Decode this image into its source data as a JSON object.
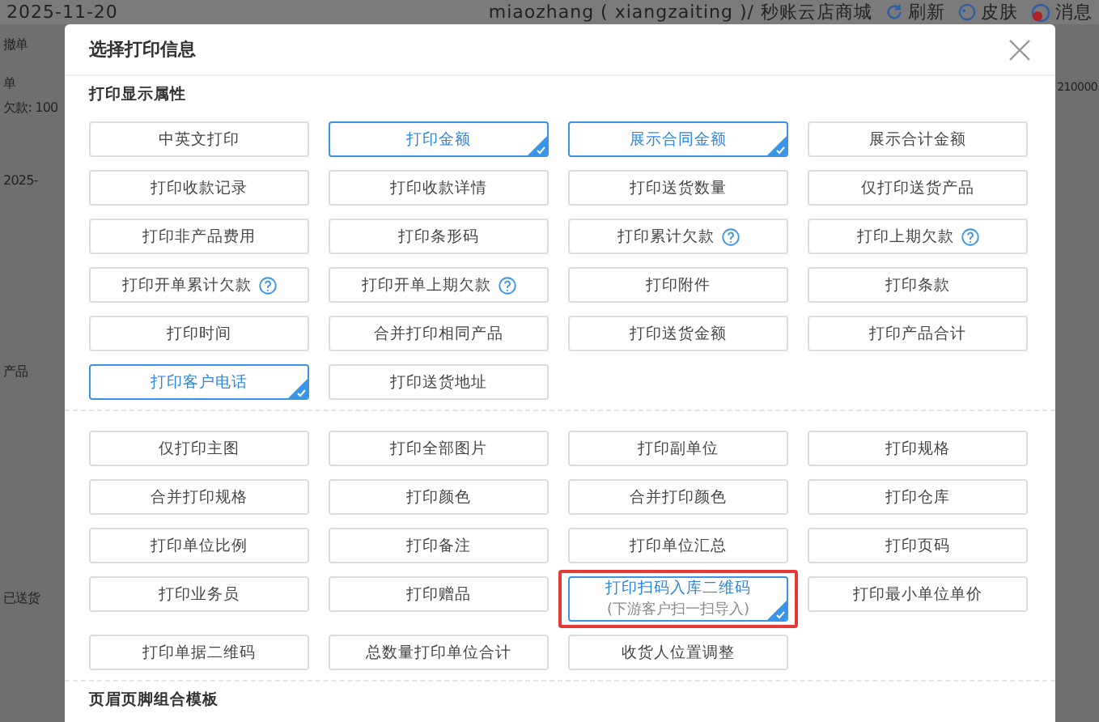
{
  "background": {
    "date": "2025-11-20",
    "user": "miaozhang ( xiangzaiting )/ 秒账云店商城",
    "actions": [
      {
        "label": "刷新",
        "kind": "refresh"
      },
      {
        "label": "皮肤",
        "kind": "skin"
      },
      {
        "label": "消息",
        "kind": "message"
      }
    ],
    "left_texts": [
      "撤单",
      "单",
      "欠款: 100",
      "2025-",
      "产品",
      "已送货"
    ],
    "right_text": "210000"
  },
  "dialog": {
    "title": "选择打印信息",
    "sections": [
      {
        "title": "打印显示属性",
        "options": [
          {
            "label": "中英文打印",
            "selected": false
          },
          {
            "label": "打印金额",
            "selected": true
          },
          {
            "label": "展示合同金额",
            "selected": true
          },
          {
            "label": "展示合计金额",
            "selected": false
          },
          {
            "label": "打印收款记录",
            "selected": false
          },
          {
            "label": "打印收款详情",
            "selected": false
          },
          {
            "label": "打印送货数量",
            "selected": false
          },
          {
            "label": "仅打印送货产品",
            "selected": false
          },
          {
            "label": "打印非产品费用",
            "selected": false
          },
          {
            "label": "打印条形码",
            "selected": false
          },
          {
            "label": "打印累计欠款",
            "selected": false,
            "help": true
          },
          {
            "label": "打印上期欠款",
            "selected": false,
            "help": true
          },
          {
            "label": "打印开单累计欠款",
            "selected": false,
            "help": true
          },
          {
            "label": "打印开单上期欠款",
            "selected": false,
            "help": true
          },
          {
            "label": "打印附件",
            "selected": false
          },
          {
            "label": "打印条款",
            "selected": false
          },
          {
            "label": "打印时间",
            "selected": false
          },
          {
            "label": "合并打印相同产品",
            "selected": false
          },
          {
            "label": "打印送货金额",
            "selected": false
          },
          {
            "label": "打印产品合计",
            "selected": false
          },
          {
            "label": "打印客户电话",
            "selected": true
          },
          {
            "label": "打印送货地址",
            "selected": false
          }
        ]
      },
      {
        "options": [
          {
            "label": "仅打印主图",
            "selected": false
          },
          {
            "label": "打印全部图片",
            "selected": false
          },
          {
            "label": "打印副单位",
            "selected": false
          },
          {
            "label": "打印规格",
            "selected": false
          },
          {
            "label": "合并打印规格",
            "selected": false
          },
          {
            "label": "打印颜色",
            "selected": false
          },
          {
            "label": "合并打印颜色",
            "selected": false
          },
          {
            "label": "打印仓库",
            "selected": false
          },
          {
            "label": "打印单位比例",
            "selected": false
          },
          {
            "label": "打印备注",
            "selected": false
          },
          {
            "label": "打印单位汇总",
            "selected": false
          },
          {
            "label": "打印页码",
            "selected": false
          },
          {
            "label": "打印业务员",
            "selected": false
          },
          {
            "label": "打印赠品",
            "selected": false
          },
          {
            "label": "打印扫码入库二维码",
            "sublabel": "(下游客户扫一扫导入)",
            "selected": true,
            "highlighted": true
          },
          {
            "label": "打印最小单位单价",
            "selected": false
          },
          {
            "label": "打印单据二维码",
            "selected": false
          },
          {
            "label": "总数量打印单位合计",
            "selected": false
          },
          {
            "label": "收货人位置调整",
            "selected": false
          }
        ]
      },
      {
        "title": "页眉页脚组合模板"
      }
    ]
  }
}
